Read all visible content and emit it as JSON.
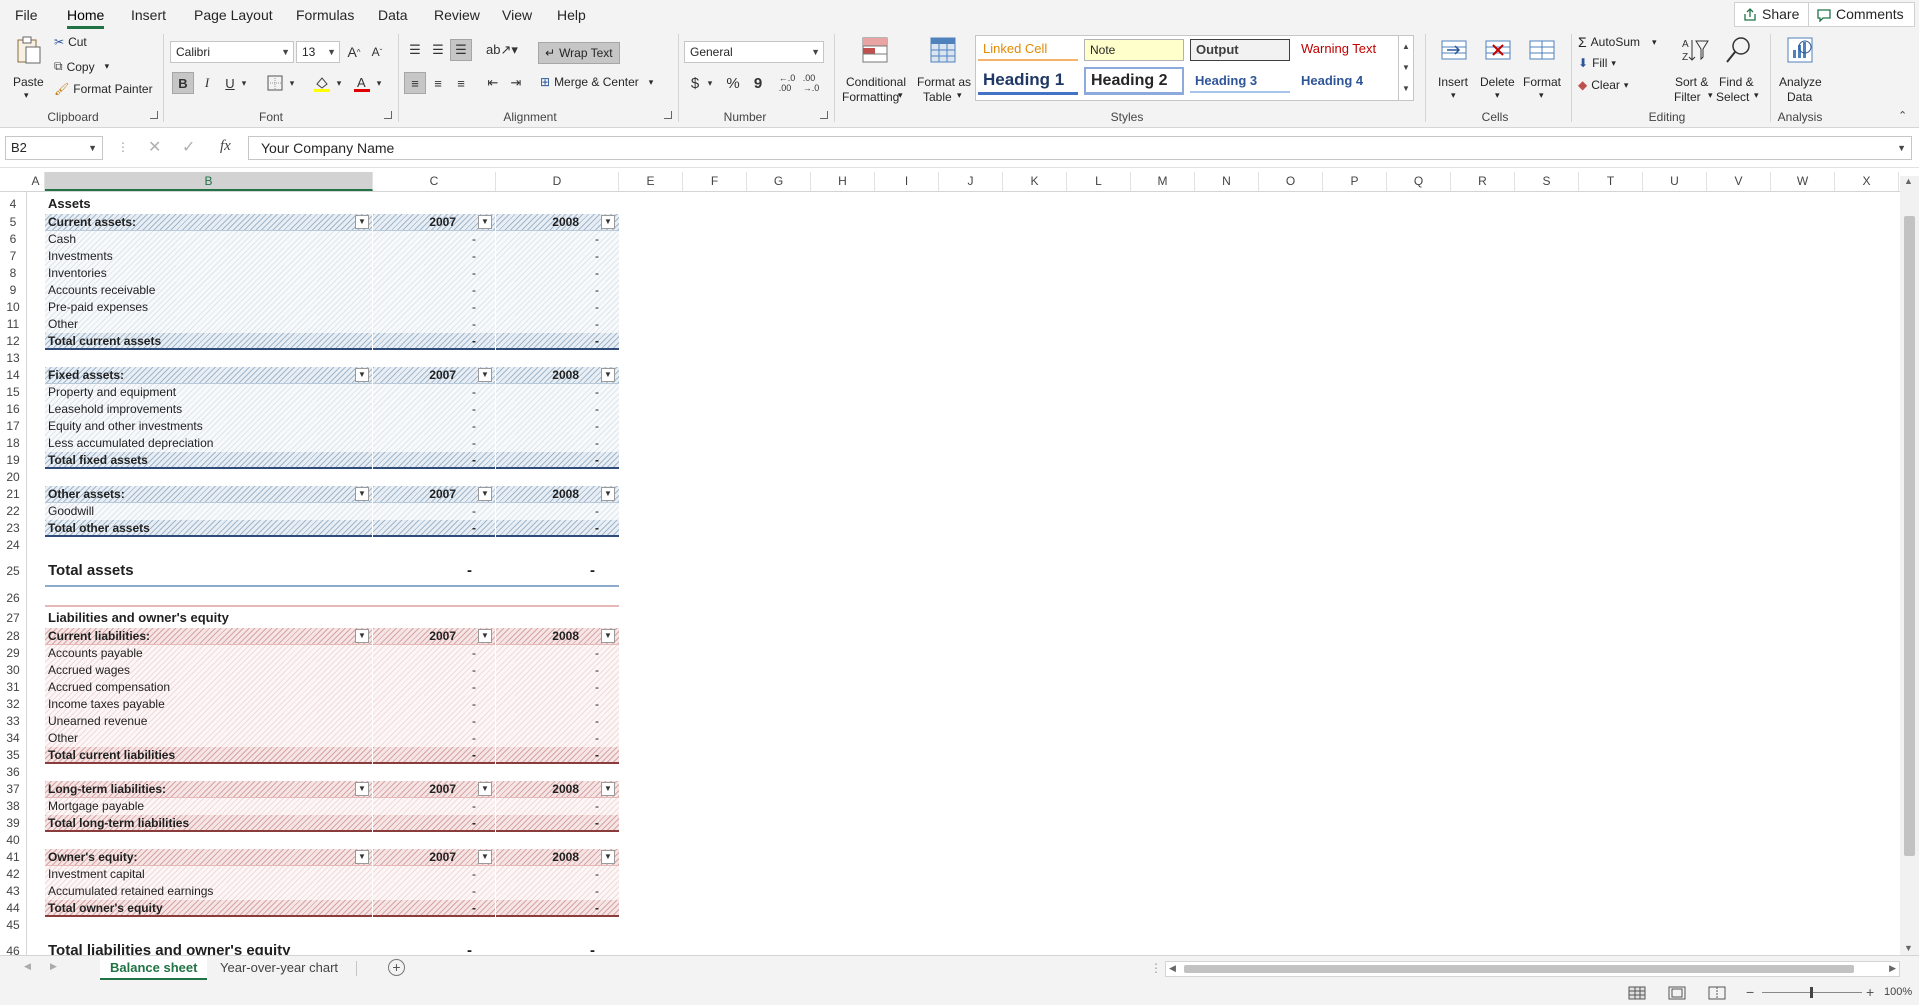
{
  "menu": {
    "tabs": [
      "File",
      "Home",
      "Insert",
      "Page Layout",
      "Formulas",
      "Data",
      "Review",
      "View",
      "Help"
    ],
    "active": "Home",
    "share": "Share",
    "comments": "Comments"
  },
  "ribbon": {
    "clipboard": {
      "paste": "Paste",
      "cut": "Cut",
      "copy": "Copy",
      "format_painter": "Format Painter",
      "label": "Clipboard"
    },
    "font": {
      "family": "Calibri",
      "size": "13",
      "label": "Font"
    },
    "alignment": {
      "wrap_text": "Wrap Text",
      "merge_center": "Merge & Center",
      "label": "Alignment"
    },
    "number": {
      "format": "General",
      "label": "Number"
    },
    "styles": {
      "conditional_formatting": [
        "Conditional",
        "Formatting"
      ],
      "format_as_table": [
        "Format as",
        "Table"
      ],
      "cells": [
        "Linked Cell",
        "Note",
        "Output",
        "Warning Text",
        "Heading 1",
        "Heading 2",
        "Heading 3",
        "Heading 4"
      ],
      "label": "Styles"
    },
    "cells": {
      "insert": "Insert",
      "delete": "Delete",
      "format": "Format",
      "label": "Cells"
    },
    "editing": {
      "autosum": "AutoSum",
      "fill": "Fill",
      "clear": "Clear",
      "sort_filter": [
        "Sort &",
        "Filter"
      ],
      "find_select": [
        "Find &",
        "Select"
      ],
      "label": "Editing"
    },
    "analysis": {
      "analyze_data": [
        "Analyze",
        "Data"
      ],
      "label": "Analysis"
    }
  },
  "formula_bar": {
    "name_box": "B2",
    "fx": "fx",
    "value": "Your Company Name"
  },
  "columns": [
    "A",
    "B",
    "C",
    "D",
    "E",
    "F",
    "G",
    "H",
    "I",
    "J",
    "K",
    "L",
    "M",
    "N",
    "O",
    "P",
    "Q",
    "R",
    "S",
    "T",
    "U",
    "V",
    "W",
    "X"
  ],
  "rows": [
    {
      "n": "4",
      "kind": "section",
      "label": "Assets"
    },
    {
      "n": "5",
      "kind": "header",
      "theme": "blue",
      "label": "Current assets:",
      "c": "2007",
      "d": "2008"
    },
    {
      "n": "6",
      "kind": "item",
      "theme": "blue",
      "label": "Cash",
      "c": "-",
      "d": "-"
    },
    {
      "n": "7",
      "kind": "item",
      "theme": "blue",
      "label": "Investments",
      "c": "-",
      "d": "-"
    },
    {
      "n": "8",
      "kind": "item",
      "theme": "blue",
      "label": "Inventories",
      "c": "-",
      "d": "-"
    },
    {
      "n": "9",
      "kind": "item",
      "theme": "blue",
      "label": "Accounts receivable",
      "c": "-",
      "d": "-"
    },
    {
      "n": "10",
      "kind": "item",
      "theme": "blue",
      "label": "Pre-paid expenses",
      "c": "-",
      "d": "-"
    },
    {
      "n": "11",
      "kind": "item",
      "theme": "blue",
      "label": "Other",
      "c": "-",
      "d": "-"
    },
    {
      "n": "12",
      "kind": "total",
      "theme": "blue",
      "label": "Total current assets",
      "c": "-",
      "d": "-"
    },
    {
      "n": "13",
      "kind": "blank"
    },
    {
      "n": "14",
      "kind": "header",
      "theme": "blue",
      "label": "Fixed assets:",
      "c": "2007",
      "d": "2008"
    },
    {
      "n": "15",
      "kind": "item",
      "theme": "blue",
      "label": "Property and equipment",
      "c": "-",
      "d": "-"
    },
    {
      "n": "16",
      "kind": "item",
      "theme": "blue",
      "label": "Leasehold improvements",
      "c": "-",
      "d": "-"
    },
    {
      "n": "17",
      "kind": "item",
      "theme": "blue",
      "label": "Equity and other investments",
      "c": "-",
      "d": "-"
    },
    {
      "n": "18",
      "kind": "item",
      "theme": "blue",
      "label": "Less accumulated depreciation",
      "c": "-",
      "d": "-"
    },
    {
      "n": "19",
      "kind": "total",
      "theme": "blue",
      "label": "Total fixed assets",
      "c": "-",
      "d": "-"
    },
    {
      "n": "20",
      "kind": "blank"
    },
    {
      "n": "21",
      "kind": "header",
      "theme": "blue",
      "label": "Other assets:",
      "c": "2007",
      "d": "2008"
    },
    {
      "n": "22",
      "kind": "item",
      "theme": "blue",
      "label": "Goodwill",
      "c": "-",
      "d": "-"
    },
    {
      "n": "23",
      "kind": "total",
      "theme": "blue",
      "label": "Total other assets",
      "c": "-",
      "d": "-"
    },
    {
      "n": "24",
      "kind": "blank"
    },
    {
      "n": "25",
      "kind": "grand",
      "theme": "blue",
      "label": "Total assets",
      "c": "-",
      "d": "-"
    },
    {
      "n": "26",
      "kind": "spacer",
      "theme": "red"
    },
    {
      "n": "27",
      "kind": "section",
      "label": "Liabilities and owner's equity"
    },
    {
      "n": "28",
      "kind": "header",
      "theme": "red",
      "label": "Current liabilities:",
      "c": "2007",
      "d": "2008"
    },
    {
      "n": "29",
      "kind": "item",
      "theme": "red",
      "label": "Accounts payable",
      "c": "-",
      "d": "-"
    },
    {
      "n": "30",
      "kind": "item",
      "theme": "red",
      "label": "Accrued wages",
      "c": "-",
      "d": "-"
    },
    {
      "n": "31",
      "kind": "item",
      "theme": "red",
      "label": "Accrued compensation",
      "c": "-",
      "d": "-"
    },
    {
      "n": "32",
      "kind": "item",
      "theme": "red",
      "label": "Income taxes payable",
      "c": "-",
      "d": "-"
    },
    {
      "n": "33",
      "kind": "item",
      "theme": "red",
      "label": "Unearned revenue",
      "c": "-",
      "d": "-"
    },
    {
      "n": "34",
      "kind": "item",
      "theme": "red",
      "label": "Other",
      "c": "-",
      "d": "-"
    },
    {
      "n": "35",
      "kind": "total",
      "theme": "red",
      "label": "Total current liabilities",
      "c": "-",
      "d": "-"
    },
    {
      "n": "36",
      "kind": "blank"
    },
    {
      "n": "37",
      "kind": "header",
      "theme": "red",
      "label": "Long-term liabilities:",
      "c": "2007",
      "d": "2008"
    },
    {
      "n": "38",
      "kind": "item",
      "theme": "red",
      "label": "Mortgage payable",
      "c": "-",
      "d": "-"
    },
    {
      "n": "39",
      "kind": "total",
      "theme": "red",
      "label": "Total long-term liabilities",
      "c": "-",
      "d": "-"
    },
    {
      "n": "40",
      "kind": "blank"
    },
    {
      "n": "41",
      "kind": "header",
      "theme": "red",
      "label": "Owner's equity:",
      "c": "2007",
      "d": "2008"
    },
    {
      "n": "42",
      "kind": "item",
      "theme": "red",
      "label": "Investment capital",
      "c": "-",
      "d": "-"
    },
    {
      "n": "43",
      "kind": "item",
      "theme": "red",
      "label": "Accumulated retained earnings",
      "c": "-",
      "d": "-"
    },
    {
      "n": "44",
      "kind": "total",
      "theme": "red",
      "label": "Total owner's equity",
      "c": "-",
      "d": "-"
    },
    {
      "n": "45",
      "kind": "blank"
    },
    {
      "n": "46",
      "kind": "grand",
      "theme": "red",
      "label": "Total liabilities and owner's equity",
      "c": "-",
      "d": "-"
    }
  ],
  "sheets": {
    "tabs": [
      "Balance sheet",
      "Year-over-year chart"
    ],
    "active": "Balance sheet"
  },
  "status": {
    "zoom": "100%"
  },
  "colors": {
    "accent": "#217346",
    "blue_rule": "#2f4b7a",
    "red_rule": "#8a3b3b"
  }
}
